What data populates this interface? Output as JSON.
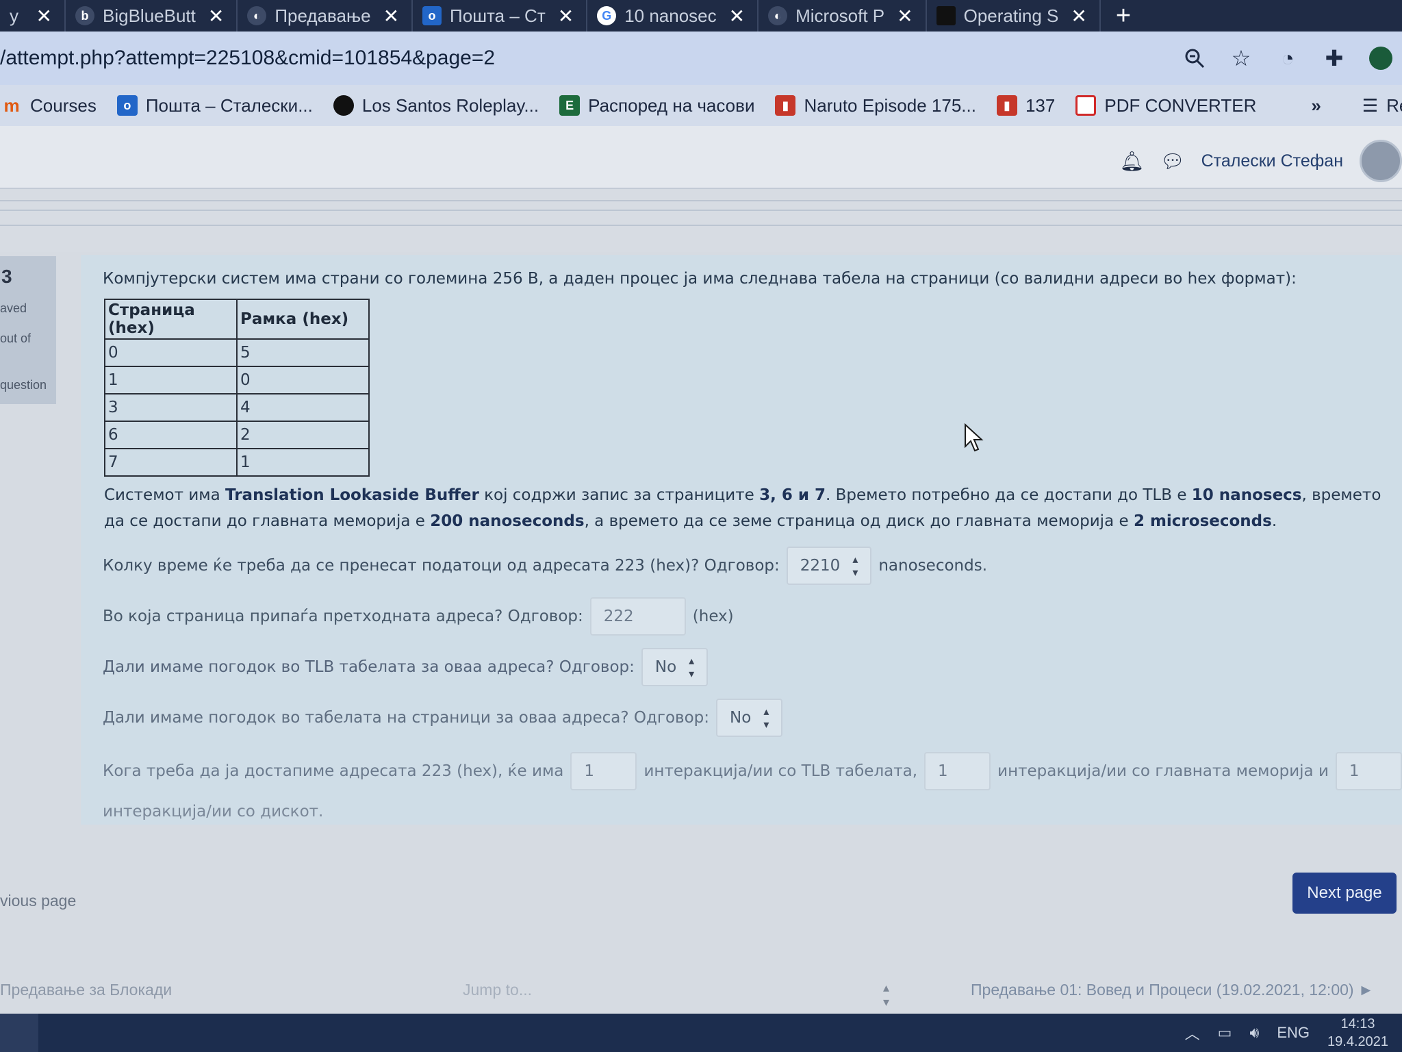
{
  "browser": {
    "tabs": [
      {
        "title": "y M",
        "icon": "gmail-icon"
      },
      {
        "title": "BigBlueButt",
        "icon": "bigbluebutton-icon"
      },
      {
        "title": "Предавање",
        "icon": "moodle-icon"
      },
      {
        "title": "Пошта – Ст",
        "icon": "outlook-icon"
      },
      {
        "title": "10 nanosec",
        "icon": "google-icon"
      },
      {
        "title": "Microsoft P",
        "icon": "moodle-icon"
      },
      {
        "title": "Operating S",
        "icon": "document-icon"
      }
    ],
    "new_tab_label": "+",
    "url": "/attempt.php?attempt=225108&cmid=101854&page=2",
    "bookmarks": [
      {
        "label": "Courses",
        "icon": "moodle-icon"
      },
      {
        "label": "Пошта – Сталески...",
        "icon": "outlook-icon"
      },
      {
        "label": "Los Santos Roleplay...",
        "icon": "circle-icon"
      },
      {
        "label": "Распоред на часови",
        "icon": "schedule-icon"
      },
      {
        "label": "Naruto Episode 175...",
        "icon": "bars-icon"
      },
      {
        "label": "137",
        "icon": "bars-icon"
      },
      {
        "label": "PDF CONVERTER",
        "icon": "pdf-icon"
      }
    ],
    "more_bookmarks": "»",
    "reading_list": "Read"
  },
  "header": {
    "user_name": "Сталески Стефан"
  },
  "question_info": {
    "number": "3",
    "saved": "aved",
    "out_of": "out of",
    "question": "question"
  },
  "question": {
    "intro": "Компјутерски систем има страни со големина 256 B, а даден процес ја има следнава табела на страници  (со валидни адреси во hex формат):",
    "table": {
      "headers": [
        "Страница (hex)",
        "Рамка (hex)"
      ],
      "rows": [
        [
          "0",
          "5"
        ],
        [
          "1",
          "0"
        ],
        [
          "3",
          "4"
        ],
        [
          "6",
          "2"
        ],
        [
          "7",
          "1"
        ]
      ]
    },
    "desc": {
      "t1": "Системот има ",
      "b1": "Translation Lookaside Buffer",
      "t2": " кој содржи запис за страниците ",
      "b2": "3, 6 и 7",
      "t3": ". Времето потребно да се достапи до TLB е ",
      "b3": "10 nanosecs",
      "t4": ", времето да се достапи до главната меморија е ",
      "b4": "200 nanoseconds",
      "t5": ", а времето да се земе страница од диск до главната меморија е ",
      "b5": "2 microseconds",
      "t6": "."
    },
    "q1": {
      "text": "Колку време ќе треба да се пренесат податоци од адресата 223 (hex)? Одговор:",
      "value": "2210",
      "suffix": "nanoseconds."
    },
    "q2": {
      "text": "Во која страница припаѓа претходната адреса? Одговор:",
      "value": "222",
      "suffix": "(hex)"
    },
    "q3": {
      "text": "Дали имаме погодок во TLB табелата за оваа адреса? Одговор:",
      "value": "No"
    },
    "q4": {
      "text": "Дали имаме погодок во табелата на страници за оваа адреса? Одговор:",
      "value": "No"
    },
    "q5": {
      "text1": "Кога треба да ја достапиме адресата 223 (hex), ќе има",
      "v1": "1",
      "text2": "интеракција/ии со TLB табелата,",
      "v2": "1",
      "text3": "интеракција/ии со главната меморија и",
      "v3": "1",
      "text4": "интеракција/ии со дискот."
    }
  },
  "nav": {
    "previous": "vious page",
    "next": "Next page",
    "footer_left": "Предавање за Блокади",
    "jump_to": "Jump to...",
    "footer_right": "Предавање 01: Вовед и Процеси (19.02.2021, 12:00) ►"
  },
  "taskbar": {
    "language": "ENG",
    "time": "14:13",
    "date": "19.4.2021"
  }
}
